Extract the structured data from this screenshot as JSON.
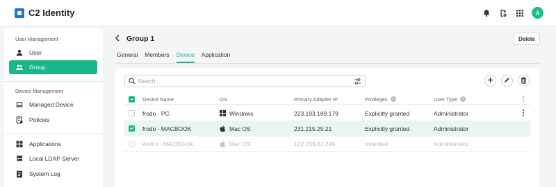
{
  "app": {
    "title": "C2 Identity",
    "avatar_initial": "A"
  },
  "sidebar": {
    "sections": [
      {
        "label": "User Management",
        "items": [
          {
            "label": "User",
            "icon": "user-icon"
          },
          {
            "label": "Group",
            "icon": "group-icon",
            "active": true
          }
        ]
      },
      {
        "label": "Device Management",
        "items": [
          {
            "label": "Managed Device",
            "icon": "laptop-icon"
          },
          {
            "label": "Policies",
            "icon": "policy-icon"
          }
        ]
      },
      {
        "label": "",
        "items": [
          {
            "label": "Applications",
            "icon": "apps-icon"
          },
          {
            "label": "Local LDAP Server",
            "icon": "server-icon"
          },
          {
            "label": "System Log",
            "icon": "log-icon"
          }
        ]
      }
    ]
  },
  "header": {
    "title": "Group 1",
    "delete_label": "Delete"
  },
  "tabs": [
    {
      "label": "General"
    },
    {
      "label": "Members"
    },
    {
      "label": "Device",
      "active": true
    },
    {
      "label": "Application"
    }
  ],
  "search": {
    "placeholder": "Search",
    "value": ""
  },
  "table": {
    "columns": [
      "Device Name",
      "OS",
      "Primary Adapter IP",
      "Privileges",
      "User Type"
    ],
    "rows": [
      {
        "name": "frodo - PC",
        "os": "Windows",
        "ip": "223.193.189.179",
        "privileges": "Explicitly granted",
        "user_type": "Administrator",
        "checked": false,
        "disabled": false
      },
      {
        "name": "frodo - MACBOOK",
        "os": "Mac OS",
        "ip": "231.215.25.21",
        "privileges": "Explicitly granted",
        "user_type": "Administrator",
        "checked": true,
        "disabled": false
      },
      {
        "name": "Aislinl - MACBOOK",
        "os": "Mac OS",
        "ip": "122.233.61.249",
        "privileges": "Inherited",
        "user_type": "Administrator",
        "checked": false,
        "disabled": true
      }
    ]
  },
  "colors": {
    "accent": "#1bb68a",
    "brand": "#1f74d4",
    "selected_row": "#e8f6f1"
  }
}
